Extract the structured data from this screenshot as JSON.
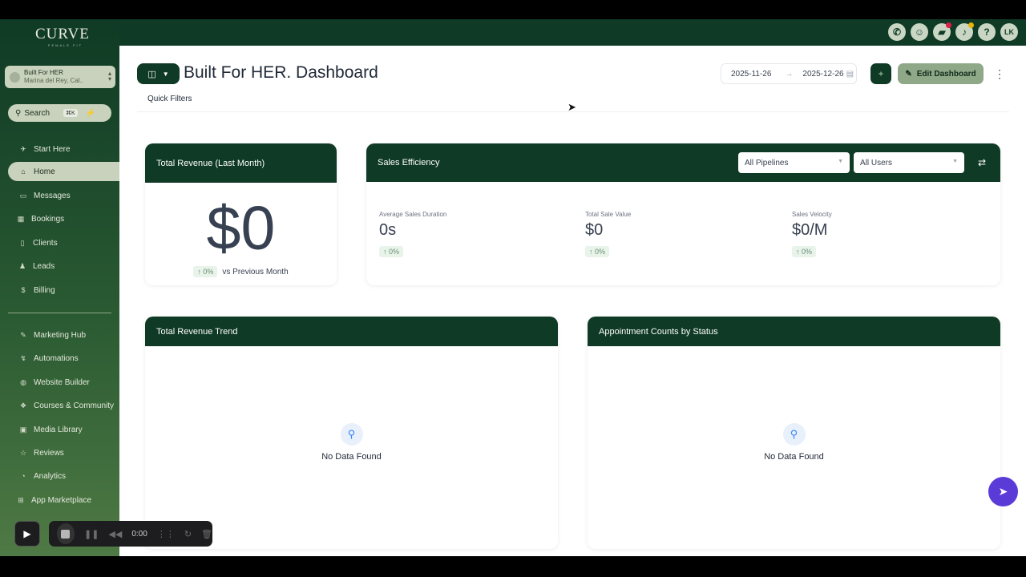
{
  "brand": {
    "logo": "CURVE",
    "logo_sub": "FEMALE FIT"
  },
  "location": {
    "name": "Built For HER",
    "address": "Marina del Rey, Cal.."
  },
  "search": {
    "label": "Search",
    "shortcut": "⌘K"
  },
  "sidebar": {
    "items": [
      {
        "label": "Start Here",
        "icon": "rocket-icon"
      },
      {
        "label": "Home",
        "icon": "home-icon",
        "active": true
      },
      {
        "label": "Messages",
        "icon": "message-icon"
      },
      {
        "label": "Bookings",
        "icon": "calendar-icon"
      },
      {
        "label": "Clients",
        "icon": "clients-icon"
      },
      {
        "label": "Leads",
        "icon": "users-icon"
      },
      {
        "label": "Billing",
        "icon": "dollar-icon"
      },
      {
        "label": "Marketing Hub",
        "icon": "megaphone-icon"
      },
      {
        "label": "Automations",
        "icon": "automation-icon"
      },
      {
        "label": "Website Builder",
        "icon": "globe-icon"
      },
      {
        "label": "Courses & Community",
        "icon": "course-icon"
      },
      {
        "label": "Media Library",
        "icon": "media-icon"
      },
      {
        "label": "Reviews",
        "icon": "star-icon"
      },
      {
        "label": "Analytics",
        "icon": "analytics-icon"
      },
      {
        "label": "App Marketplace",
        "icon": "apps-icon"
      }
    ]
  },
  "topbar": {
    "avatar_initials": "LK",
    "help": "?"
  },
  "header": {
    "title": "Built For HER. Dashboard",
    "date_start": "2025-11-26",
    "date_end": "2025-12-26",
    "edit_label": "Edit Dashboard",
    "quick_filters": "Quick Filters"
  },
  "revenue_card": {
    "title": "Total Revenue (Last Month)",
    "value": "$0",
    "change": "↑ 0%",
    "compare": "vs Previous Month"
  },
  "sales_card": {
    "title": "Sales Efficiency",
    "pipeline_select": "All Pipelines",
    "users_select": "All Users",
    "metrics": [
      {
        "label": "Average Sales Duration",
        "value": "0s",
        "change": "↑ 0%"
      },
      {
        "label": "Total Sale Value",
        "value": "$0",
        "change": "↑ 0%"
      },
      {
        "label": "Sales Velocity",
        "value": "$0/M",
        "change": "↑ 0%"
      }
    ]
  },
  "trend_card": {
    "title": "Total Revenue Trend",
    "empty": "No Data Found"
  },
  "appt_card": {
    "title": "Appointment Counts by Status",
    "empty": "No Data Found"
  },
  "recorder": {
    "time": "0:00"
  },
  "colors": {
    "primary": "#0f3a25",
    "accent": "#8fa888",
    "chat": "#5b3bd8"
  }
}
